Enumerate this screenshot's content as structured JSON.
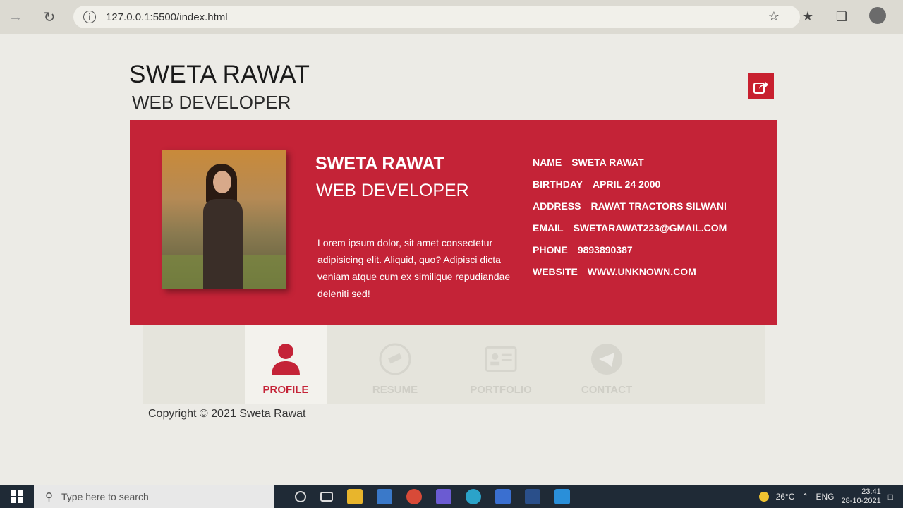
{
  "browser": {
    "url": "127.0.0.1:5500/index.html"
  },
  "header": {
    "name": "SWETA RAWAT",
    "role": "WEB DEVELOPER"
  },
  "card": {
    "name": "SWETA RAWAT",
    "role": "WEB DEVELOPER",
    "description": "Lorem ipsum dolor, sit amet consectetur adipisicing elit. Aliquid, quo? Adipisci dicta veniam atque cum ex similique repudiandae deleniti sed!",
    "details": [
      {
        "label": "NAME",
        "value": "SWETA RAWAT"
      },
      {
        "label": "BIRTHDAY",
        "value": "APRIL 24 2000"
      },
      {
        "label": "ADDRESS",
        "value": "RAWAT TRACTORS SILWANI"
      },
      {
        "label": "EMAIL",
        "value": "SWETARAWAT223@GMAIL.COM"
      },
      {
        "label": "PHONE",
        "value": "9893890387"
      },
      {
        "label": "WEBSITE",
        "value": "WWW.UNKNOWN.COM"
      }
    ]
  },
  "tabs": [
    {
      "label": "PROFILE",
      "icon": "user-icon"
    },
    {
      "label": "RESUME",
      "icon": "telescope-icon"
    },
    {
      "label": "PORTFOLIO",
      "icon": "id-card-icon"
    },
    {
      "label": "CONTACT",
      "icon": "paper-plane-icon"
    }
  ],
  "footer": {
    "copyright": "Copyright © 2021 Sweta Rawat"
  },
  "taskbar": {
    "search_placeholder": "Type here to search",
    "weather": "26°C",
    "language": "ENG",
    "time": "23:41",
    "date": "28-10-2021"
  },
  "colors": {
    "accent": "#c42337",
    "taskbar": "#1f2a36"
  }
}
